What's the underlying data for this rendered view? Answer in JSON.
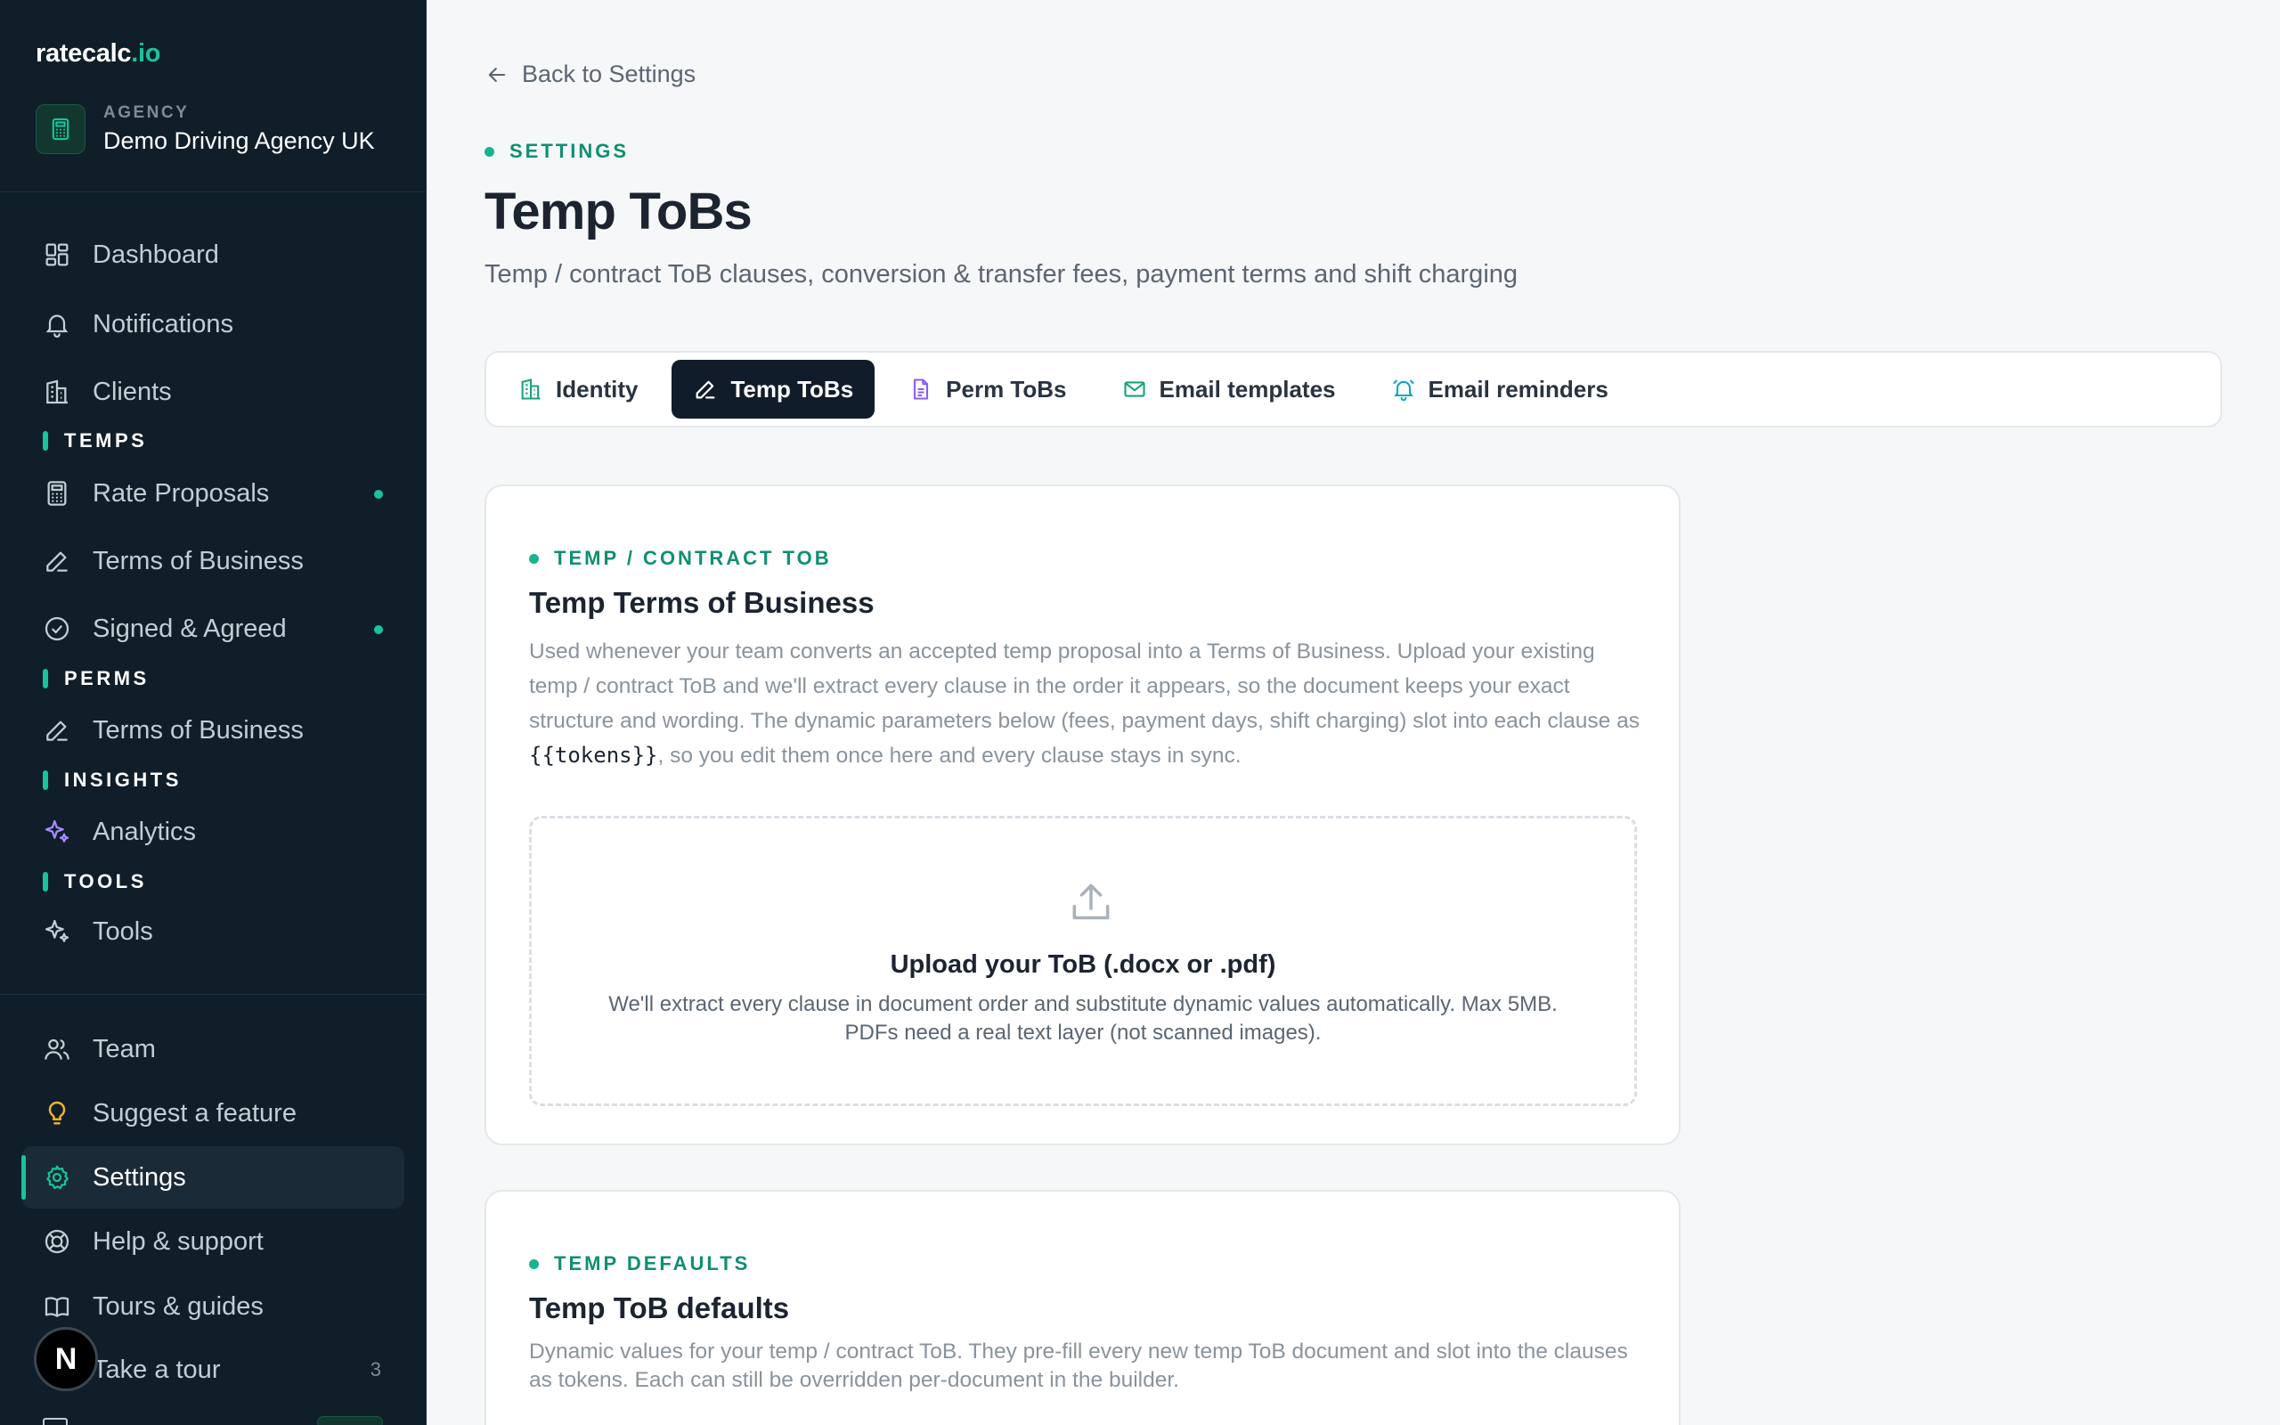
{
  "brand": {
    "name": "ratecalc",
    "suffix": ".io"
  },
  "agency": {
    "label": "AGENCY",
    "name": "Demo Driving Agency UK"
  },
  "sidebar": {
    "nav_top": [
      {
        "label": "Dashboard",
        "icon": "dashboard-icon"
      },
      {
        "label": "Notifications",
        "icon": "bell-icon"
      },
      {
        "label": "Clients",
        "icon": "building-icon"
      }
    ],
    "sections": {
      "temps": "TEMPS",
      "perms": "PERMS",
      "insights": "INSIGHTS",
      "tools": "TOOLS"
    },
    "temps_items": [
      {
        "label": "Rate Proposals",
        "icon": "calculator-icon",
        "dot": true
      },
      {
        "label": "Terms of Business",
        "icon": "pen-icon",
        "dot": false
      },
      {
        "label": "Signed & Agreed",
        "icon": "check-circle-icon",
        "dot": true
      }
    ],
    "perms_items": [
      {
        "label": "Terms of Business",
        "icon": "pen-icon"
      }
    ],
    "insights_items": [
      {
        "label": "Analytics",
        "icon": "sparkles-icon",
        "color": "#a78bfa"
      }
    ],
    "tools_items": [
      {
        "label": "Tools",
        "icon": "sparkle-icon"
      }
    ],
    "nav_bottom": [
      {
        "label": "Team",
        "icon": "users-icon"
      },
      {
        "label": "Suggest a feature",
        "icon": "lightbulb-icon",
        "color": "#f0b429"
      },
      {
        "label": "Settings",
        "icon": "gear-icon",
        "active": true
      },
      {
        "label": "Help & support",
        "icon": "lifebuoy-icon"
      },
      {
        "label": "Tours & guides",
        "icon": "book-icon"
      },
      {
        "label": "Take a tour",
        "icon": "play-icon",
        "count": "3"
      }
    ],
    "avatar": "N"
  },
  "main": {
    "back_label": "Back to Settings",
    "eyebrow": "SETTINGS",
    "title": "Temp ToBs",
    "subtitle": "Temp / contract ToB clauses, conversion & transfer fees, payment terms and shift charging",
    "tabs": [
      {
        "label": "Identity",
        "icon": "building-icon",
        "color": "#19a37f"
      },
      {
        "label": "Temp ToBs",
        "icon": "pen-icon",
        "active": true
      },
      {
        "label": "Perm ToBs",
        "icon": "document-icon",
        "color": "#8b5cf6"
      },
      {
        "label": "Email templates",
        "icon": "mail-icon",
        "color": "#19a37f"
      },
      {
        "label": "Email reminders",
        "icon": "bell-icon",
        "color": "#0ea5c6"
      }
    ],
    "tob_card": {
      "eyebrow": "TEMP / CONTRACT TOB",
      "title": "Temp Terms of Business",
      "text_before": "Used whenever your team converts an accepted temp proposal into a Terms of Business. Upload your existing temp / contract ToB and we'll extract every clause in the order it appears, so the document keeps your exact structure and wording. The dynamic parameters below (fees, payment days, shift charging) slot into each clause as ",
      "text_code": "{{tokens}}",
      "text_after": ", so you edit them once here and every clause stays in sync.",
      "upload_title": "Upload your ToB (.docx or .pdf)",
      "upload_desc": "We'll extract every clause in document order and substitute dynamic values automatically. Max 5MB. PDFs need a real text layer (not scanned images)."
    },
    "defaults_card": {
      "eyebrow": "TEMP DEFAULTS",
      "title": "Temp ToB defaults",
      "text": "Dynamic values for your temp / contract ToB. They pre-fill every new temp ToB document and slot into the clauses as tokens. Each can still be overridden per-document in the builder."
    }
  },
  "colors": {
    "accent": "#19c39b",
    "sidebar_bg": "#0f1e28",
    "active_tab": "#111c2b"
  }
}
